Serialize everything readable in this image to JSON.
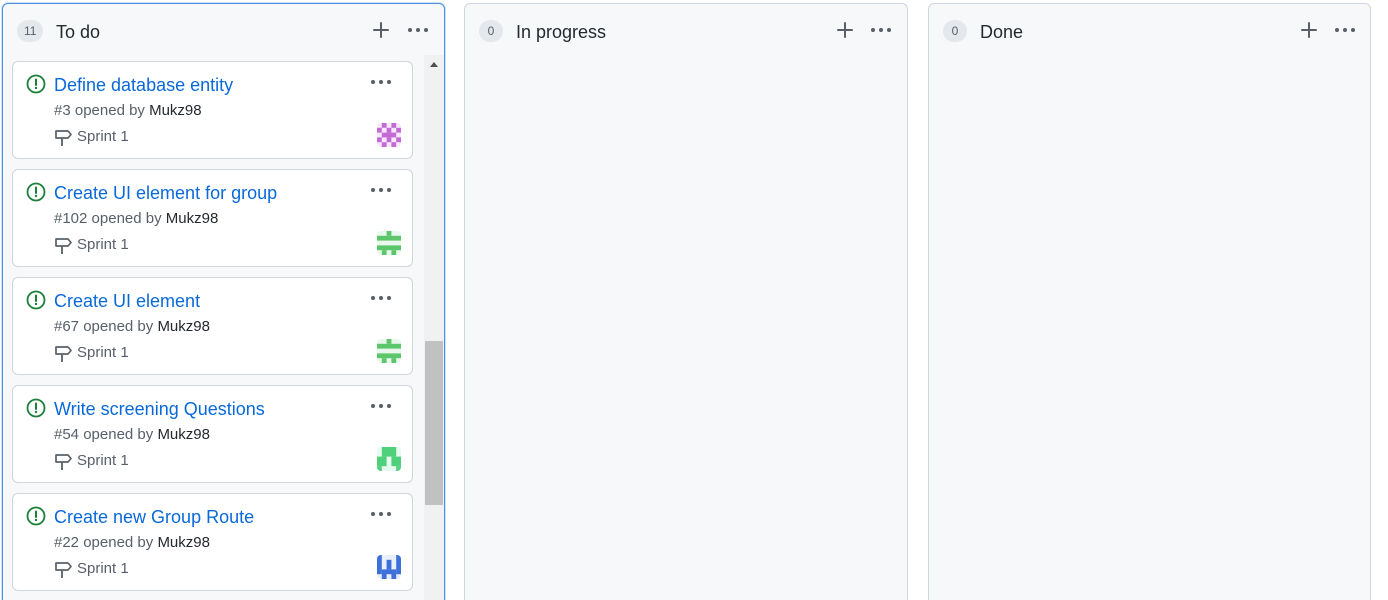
{
  "columns": [
    {
      "title": "To do",
      "count": "11"
    },
    {
      "title": "In progress",
      "count": "0"
    },
    {
      "title": "Done",
      "count": "0"
    }
  ],
  "cards": [
    {
      "title": "Define database entity",
      "number": "#3",
      "opened_by": " opened by ",
      "author": "Mukz98",
      "milestone": "Sprint 1"
    },
    {
      "title": "Create UI element for group",
      "number": "#102",
      "opened_by": " opened by ",
      "author": "Mukz98",
      "milestone": "Sprint 1"
    },
    {
      "title": "Create UI element",
      "number": "#67",
      "opened_by": " opened by ",
      "author": "Mukz98",
      "milestone": "Sprint 1"
    },
    {
      "title": "Write screening Questions",
      "number": "#54",
      "opened_by": " opened by ",
      "author": "Mukz98",
      "milestone": "Sprint 1"
    },
    {
      "title": "Create new Group Route",
      "number": "#22",
      "opened_by": " opened by ",
      "author": "Mukz98",
      "milestone": "Sprint 1"
    }
  ],
  "colors": {
    "issue_open": "#1a7f37",
    "link": "#0969da",
    "avatar_purple": "#c36ad6",
    "avatar_green": "#5cc76a",
    "avatar_green2": "#4fd17c",
    "avatar_blue": "#3f6fd8"
  },
  "icons": {
    "add": "plus-icon",
    "more": "kebab-horizontal-icon",
    "issue": "issue-opened-icon",
    "milestone": "milestone-icon"
  }
}
